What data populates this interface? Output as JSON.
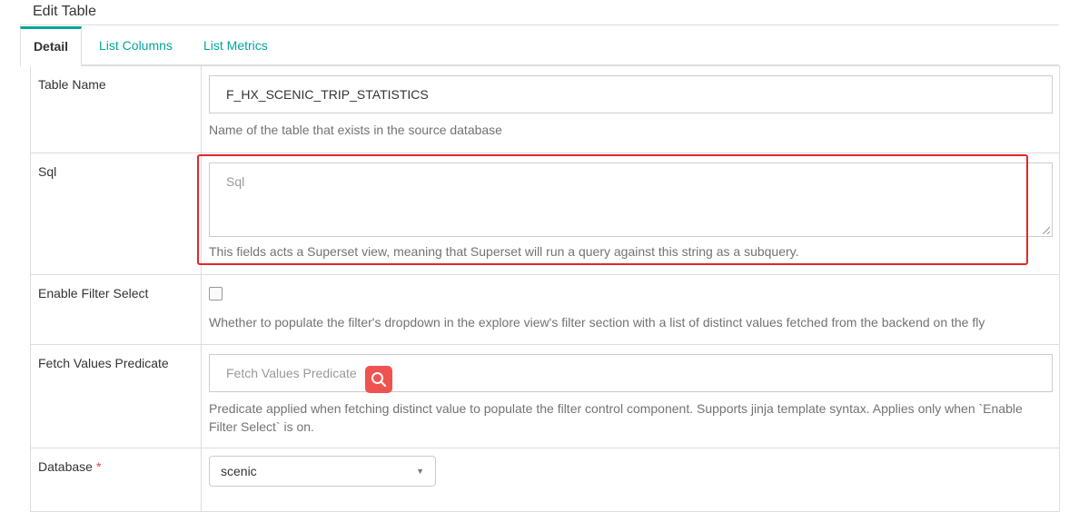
{
  "panel": {
    "title": "Edit Table"
  },
  "tabs": [
    {
      "label": "Detail",
      "active": true
    },
    {
      "label": "List Columns",
      "active": false
    },
    {
      "label": "List Metrics",
      "active": false
    }
  ],
  "fields": {
    "table_name": {
      "label": "Table Name",
      "value": "F_HX_SCENIC_TRIP_STATISTICS",
      "help": "Name of the table that exists in the source database"
    },
    "sql": {
      "label": "Sql",
      "placeholder": "Sql",
      "help": "This fields acts a Superset view, meaning that Superset will run a query against this string as a subquery."
    },
    "enable_filter_select": {
      "label": "Enable Filter Select",
      "checked": false,
      "help": "Whether to populate the filter's dropdown in the explore view's filter section with a list of distinct values fetched from the backend on the fly"
    },
    "fetch_values_predicate": {
      "label": "Fetch Values Predicate",
      "placeholder": "Fetch Values Predicate",
      "help": "Predicate applied when fetching distinct value to populate the filter control component. Supports jinja template syntax. Applies only when `Enable Filter Select` is on."
    },
    "database": {
      "label": "Database",
      "required_mark": "*",
      "selected": "scenic"
    }
  },
  "colors": {
    "accent": "#00a699",
    "highlight": "#e3262b",
    "badge": "#ef5350"
  },
  "icons": {
    "search_badge": "search-icon",
    "select_caret": "caret-down-icon"
  }
}
